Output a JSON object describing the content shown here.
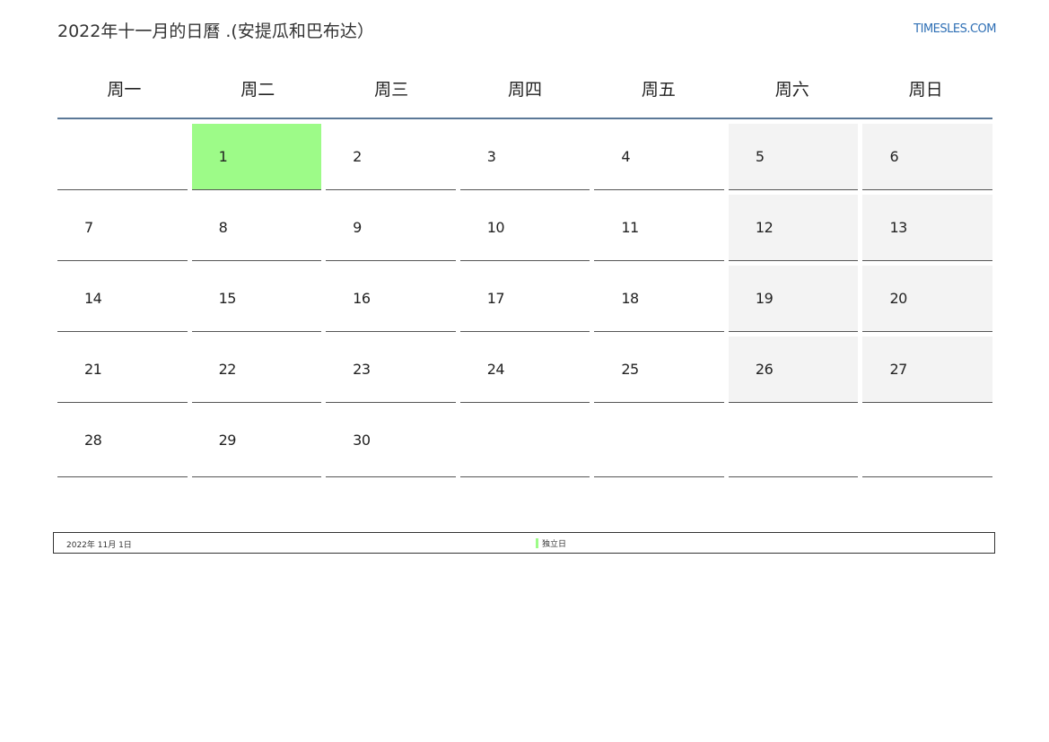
{
  "header": {
    "title": "2022年十一月的日曆 .(安提瓜和巴布达）",
    "site": "TIMESLES.COM"
  },
  "calendar": {
    "weekdays": [
      "周一",
      "周二",
      "周三",
      "周四",
      "周五",
      "周六",
      "周日"
    ],
    "weeks": [
      [
        "",
        "1",
        "2",
        "3",
        "4",
        "5",
        "6"
      ],
      [
        "7",
        "8",
        "9",
        "10",
        "11",
        "12",
        "13"
      ],
      [
        "14",
        "15",
        "16",
        "17",
        "18",
        "19",
        "20"
      ],
      [
        "21",
        "22",
        "23",
        "24",
        "25",
        "26",
        "27"
      ],
      [
        "28",
        "29",
        "30",
        "",
        "",
        "",
        ""
      ]
    ],
    "holiday_color": "#9dfb88",
    "weekend_color": "#f3f3f3"
  },
  "legend": {
    "date": "2022年 11月 1日",
    "holiday_name": "独立日"
  }
}
